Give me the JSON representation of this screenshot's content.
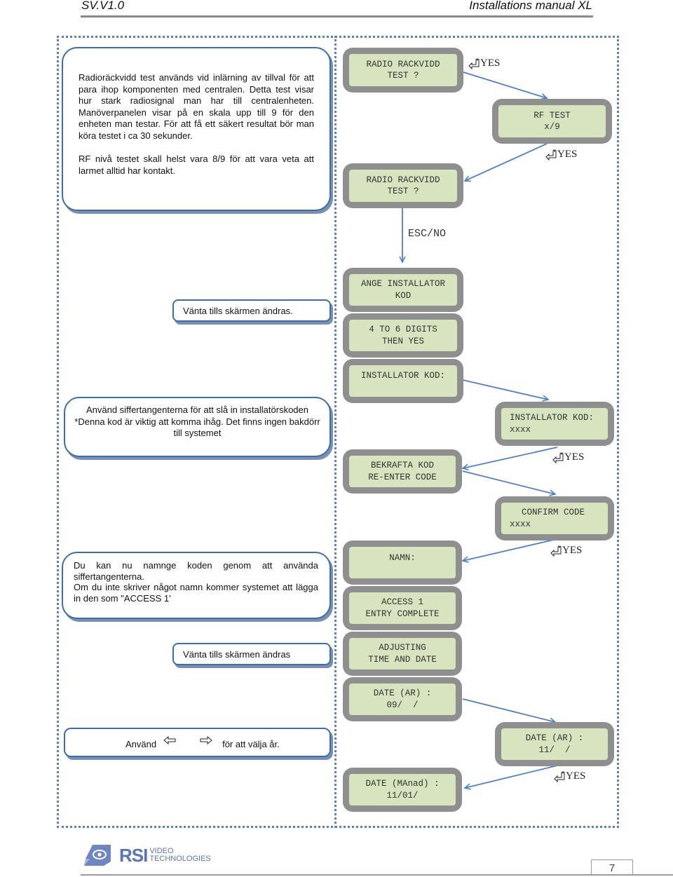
{
  "header": {
    "version": "SV.V1.0",
    "title": "Installations manual XL"
  },
  "notes": {
    "radio_intro": {
      "p1": "Radioräckvidd test används vid inlärning av tillval för att para ihop komponenten med centralen.  Detta test visar hur stark radiosignal man har till centralenheten. Manöverpanelen visar på en skala upp till 9 för den enheten man testar.  För att få ett säkert resultat bör man köra testet i ca 30 sekunder.",
      "p2": "RF nivå testet skall helst vara 8/9 för att vara veta att larmet alltid har kontakt."
    },
    "wait1": "Vänta tills skärmen ändras.",
    "code_entry": {
      "line1": "Använd siffertangenterna för att slå in installatörskoden",
      "line2": "*Denna kod  är viktig att komma ihåg. Det finns ingen bakdörr",
      "line3": "till systemet"
    },
    "naming": {
      "line1": "Du kan nu namnge koden genom att använda siffertangenterna.",
      "line2": "Om du inte skriver något namn kommer systemet att lägga in den som \"ACCESS 1'"
    },
    "wait2": "Vänta tills skärmen ändras",
    "year_select": {
      "before": "Använd",
      "after": "för att välja år.",
      "left_icon": "left-arrow-key-icon",
      "right_icon": "right-arrow-key-icon"
    }
  },
  "screens": {
    "radio_test_1": [
      "RADIO RACKVIDD",
      "TEST ?"
    ],
    "rf_test": [
      "RF TEST",
      "x/9"
    ],
    "radio_test_2": [
      "RADIO RACKVIDD",
      "TEST ?"
    ],
    "ange_kod": [
      "ANGE INSTALLATOR",
      "KOD"
    ],
    "digits": [
      "4 TO 6 DIGITS",
      "THEN YES"
    ],
    "installator_kod": [
      "INSTALLATOR KOD:",
      ""
    ],
    "installator_kod_x": [
      "INSTALLATOR KOD:",
      "xxxx"
    ],
    "bekrafta": [
      "BEKRAFTA KOD",
      "RE-ENTER CODE"
    ],
    "confirm": [
      "CONFIRM CODE",
      "xxxx"
    ],
    "namn": [
      "NAMN:",
      ""
    ],
    "access": [
      "ACCESS 1",
      "ENTRY COMPLETE"
    ],
    "adjusting": [
      "ADJUSTING",
      "TIME AND DATE"
    ],
    "date_ar_09": [
      "DATE (AR) :",
      "09/  /"
    ],
    "date_ar_11": [
      "DATE (AR) :",
      "11/  /"
    ],
    "date_manad": [
      "DATE (MAnad) :",
      "11/01/"
    ]
  },
  "labels": {
    "yes": "YES",
    "esc_no": "ESC/NO",
    "yes_icon": "enter-key-icon"
  },
  "footer": {
    "brand": "RSI",
    "brand_sub1": "VIDEO",
    "brand_sub2": "TECHNOLOGIES",
    "page_number": "7"
  },
  "colors": {
    "lcd_bg": "#d8e3bf",
    "lcd_frame": "#8f8f8f",
    "arrow": "#4f7fc4",
    "note_border": "#3d6ea8",
    "dotted_frame": "#5b7fbf",
    "brand": "#5b74b5"
  }
}
